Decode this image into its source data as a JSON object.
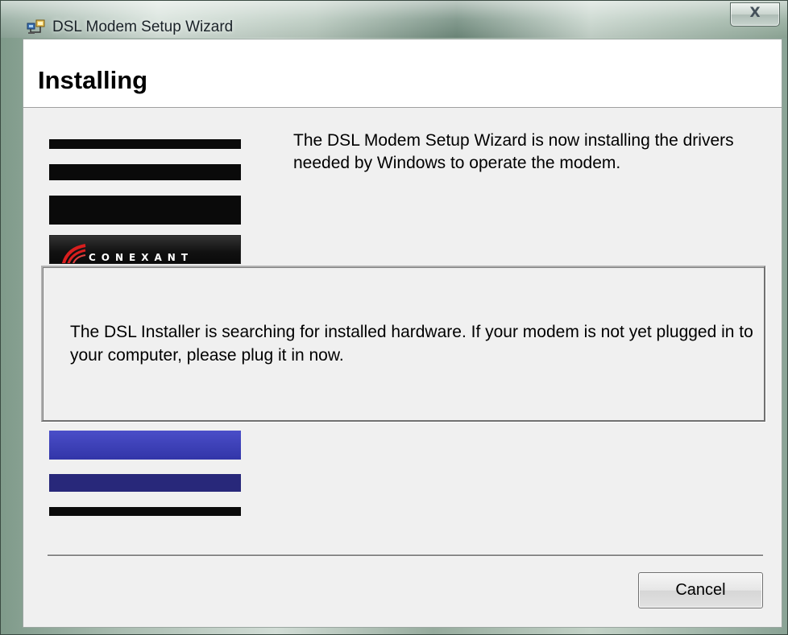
{
  "window": {
    "title": "DSL Modem Setup Wizard",
    "close_glyph": "X",
    "app_icon": "network-setup-icon"
  },
  "header": {
    "title": "Installing"
  },
  "content": {
    "message": "The DSL Modem Setup Wizard is now installing the drivers needed by Windows to operate the modem."
  },
  "branding": {
    "logo_text": "CONEXANT",
    "stripe_colors_top": [
      "#0a0a0a",
      "#0a0a0a",
      "#0a0a0a"
    ],
    "stripe_colors_bottom": [
      "#3c3fb8",
      "#28287a",
      "#0a0a0a"
    ]
  },
  "status_panel": {
    "message": "The DSL Installer is searching for installed hardware.  If your modem is not yet plugged in to your computer, please plug it in now."
  },
  "buttons": {
    "cancel_label": "Cancel"
  }
}
